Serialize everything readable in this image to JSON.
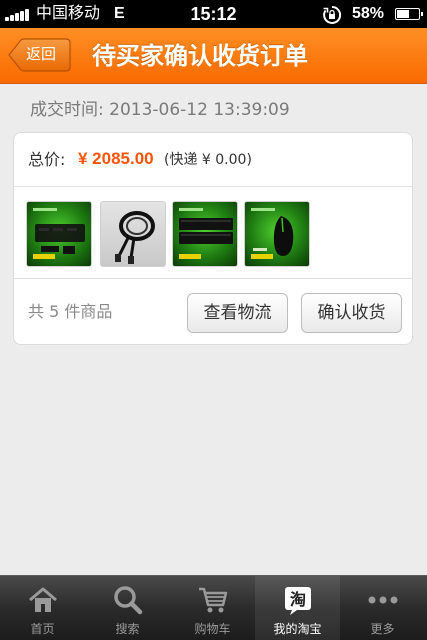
{
  "status_bar": {
    "carrier": "中国移动",
    "network": "E",
    "time": "15:12",
    "battery": "58%",
    "battery_level": 0.58
  },
  "nav": {
    "back_label": "返回",
    "title": "待买家确认收货订单"
  },
  "order": {
    "deal_time": "成交时间: 2013-06-12 13:39:09",
    "total_label": "总价:",
    "total_amount": "¥ 2085.00",
    "shipping": "(快递 ¥ 0.00)",
    "item_count": "共 5 件商品",
    "thumbnails": [
      {
        "icon": "razer-keyboard-image"
      },
      {
        "icon": "cable-image"
      },
      {
        "icon": "razer-keyboard-image"
      },
      {
        "icon": "razer-mouse-image"
      }
    ],
    "logistics_button": "查看物流",
    "confirm_button": "确认收货"
  },
  "tab_bar": {
    "items": [
      {
        "label": "首页",
        "icon": "home-icon"
      },
      {
        "label": "搜索",
        "icon": "search-icon"
      },
      {
        "label": "购物车",
        "icon": "cart-icon"
      },
      {
        "label": "我的淘宝",
        "icon": "taobao-icon",
        "active": true,
        "icon_text": "淘"
      },
      {
        "label": "更多",
        "icon": "more-icon"
      }
    ]
  },
  "colors": {
    "accent": "#f86a00",
    "price": "#f5560a"
  }
}
